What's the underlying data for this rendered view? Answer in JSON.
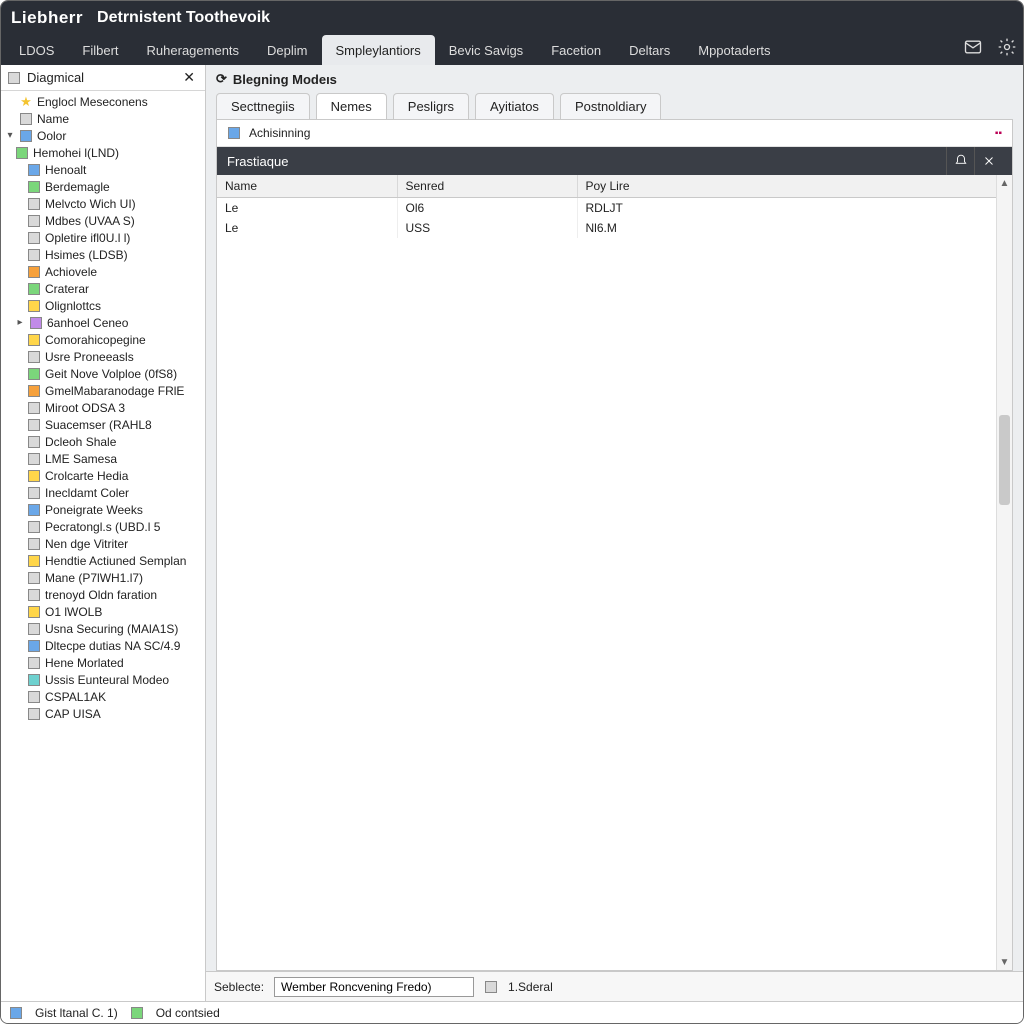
{
  "header": {
    "brand": "Liebherr",
    "title": "Detrnistent Toothevoik"
  },
  "menu": {
    "items": [
      {
        "label": "LDOS"
      },
      {
        "label": "Filbert"
      },
      {
        "label": "Ruheragements"
      },
      {
        "label": "Deplim"
      },
      {
        "label": "Smpleylantiors",
        "active": true
      },
      {
        "label": "Bevic Savigs"
      },
      {
        "label": "Facetion"
      },
      {
        "label": "Deltars"
      },
      {
        "label": "Mppotaderts"
      }
    ]
  },
  "sidebar": {
    "title": "Diagmical",
    "favorites": "Englocl Meseconens",
    "root1": "Name",
    "root2": "Oolor",
    "items": [
      "Hemohei l(LND)",
      "Henoalt",
      "Berdemagle",
      "Melvcto Wich UI)",
      "Mdbes (UVAA S)",
      "Opletire ifl0U.l l)",
      "Hsimes (LDSB)",
      "Achiovele",
      "Craterar",
      "Olignlottcs",
      "6anhoel Ceneo",
      "Comorahicopegine",
      "Usre Proneeasls",
      "Geit Nove Volploe (0fS8)",
      "GmelMabaranodage FRlE",
      "Miroot ODSA 3",
      "Suacemser (RAHL8",
      "Dcleoh Shale",
      "LME Samesa",
      "Crolcarte Hedia",
      "Inecldamt Coler",
      "Poneigrate Weeks",
      "Pecratongl.s (UBD.l 5",
      "Nen dge Vitriter",
      "Hendtie Actiuned Semplan",
      "Mane (P7lWH1.l7)",
      "trenoyd Oldn faration",
      "O1 lWOLB",
      "Usna Securing (MAlA1S)",
      "Dltecpe dutias NA SC/4.9",
      "Hene Morlated",
      "Ussis Eunteural Modeo",
      "CSPAL1AK",
      "CAP UISA"
    ]
  },
  "main": {
    "heading": "Blegning Modeıs",
    "tabs": [
      {
        "label": "Secttnegiis"
      },
      {
        "label": "Nemes",
        "active": true
      },
      {
        "label": "Pesligrs"
      },
      {
        "label": "Ayitiatos"
      },
      {
        "label": "Postnoldiary"
      }
    ],
    "subhead": "Achisinning",
    "band_title": "Frastiaque",
    "columns": [
      "Name",
      "Senred",
      "Poy Lire"
    ],
    "rows": [
      {
        "c0": "Le",
        "c1": "Ol6",
        "c2": "RDLJT"
      },
      {
        "c0": "Le",
        "c1": "USS",
        "c2": "Nl6.M"
      }
    ]
  },
  "footer": {
    "label": "Seblecte:",
    "input_value": "Wember Roncvening Fredo)",
    "right": "1.Sderal"
  },
  "status": {
    "left": "Gist ltanal C. 1)",
    "right": "Od contsied"
  }
}
